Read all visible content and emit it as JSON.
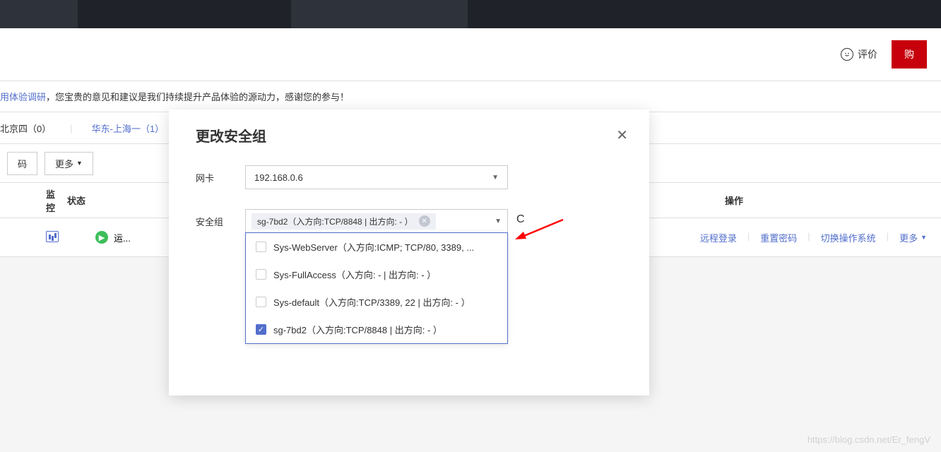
{
  "header": {
    "rating_label": "评价",
    "buy_label": "购"
  },
  "notice": {
    "link_text": "用体验调研",
    "text": "，您宝贵的意见和建议是我们持续提升产品体验的源动力，感谢您的参与！"
  },
  "region_tabs": {
    "tab1": "北京四（0）",
    "tab2": "华东-上海一（1）"
  },
  "toolbar": {
    "btn1": "码",
    "more_label": "更多"
  },
  "table": {
    "headers": {
      "monitor": "监控",
      "status": "状态",
      "actions": "操作"
    },
    "row": {
      "status_text": "运...",
      "actions": {
        "remote_login": "远程登录",
        "reset_password": "重置密码",
        "switch_os": "切换操作系统",
        "more": "更多"
      }
    }
  },
  "modal": {
    "title": "更改安全组",
    "nic_label": "网卡",
    "nic_value": "192.168.0.6",
    "sg_label": "安全组",
    "selected_sg": "sg-7bd2（入方向:TCP/8848 | 出方向: - ）",
    "options": [
      {
        "label": "Sys-WebServer（入方向:ICMP; TCP/80, 3389, ...",
        "checked": false
      },
      {
        "label": "Sys-FullAccess（入方向: -  | 出方向: - ）",
        "checked": false
      },
      {
        "label": "Sys-default（入方向:TCP/3389, 22 | 出方向: - ）",
        "checked": false
      },
      {
        "label": "sg-7bd2（入方向:TCP/8848 | 出方向: - ）",
        "checked": true
      }
    ]
  },
  "watermark": "https://blog.csdn.net/Er_fengV"
}
